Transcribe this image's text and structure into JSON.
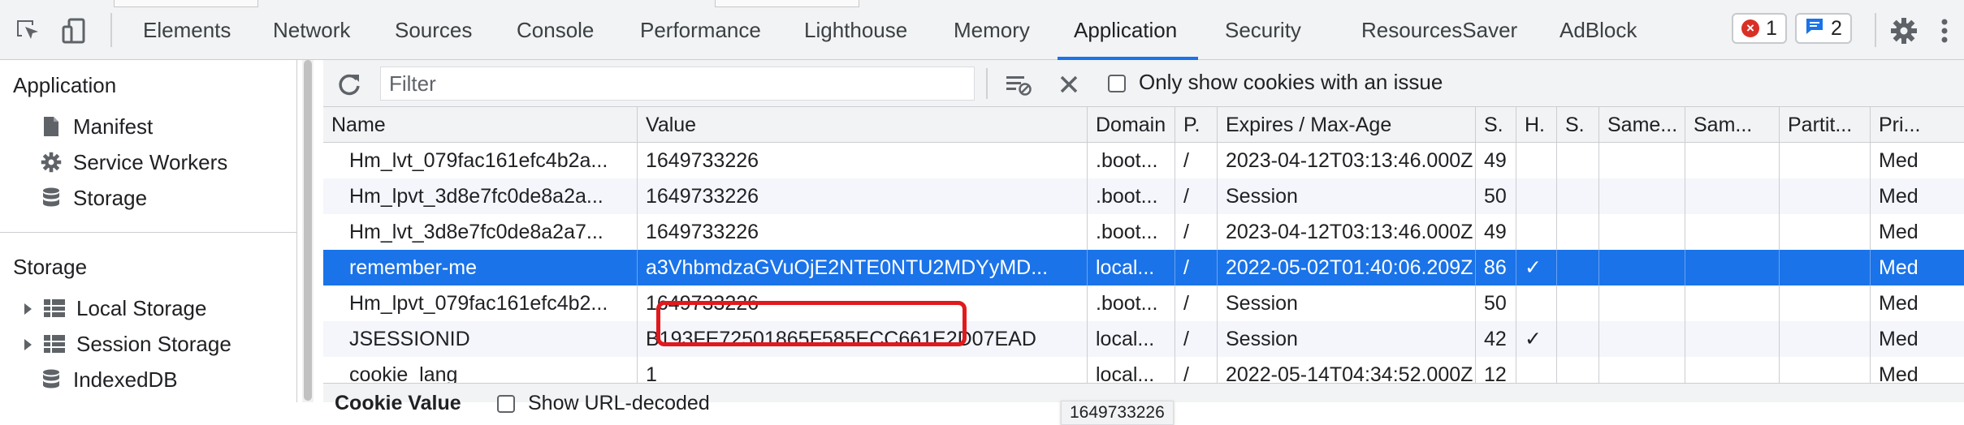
{
  "topbar": {
    "tabs": [
      "Elements",
      "Network",
      "Sources",
      "Console",
      "Performance",
      "Lighthouse",
      "Memory",
      "Application",
      "Security",
      "ResourcesSaver",
      "AdBlock"
    ],
    "active_tab": "Application",
    "error_count": "1",
    "message_count": "2"
  },
  "sidebar": {
    "application_heading": "Application",
    "application_items": [
      {
        "label": "Manifest",
        "icon": "document-icon"
      },
      {
        "label": "Service Workers",
        "icon": "gear-icon"
      },
      {
        "label": "Storage",
        "icon": "database-icon"
      }
    ],
    "storage_heading": "Storage",
    "storage_items": [
      {
        "label": "Local Storage",
        "icon": "grid-icon"
      },
      {
        "label": "Session Storage",
        "icon": "grid-icon"
      },
      {
        "label": "IndexedDB",
        "icon": "database-icon"
      }
    ]
  },
  "toolbar": {
    "filter_placeholder": "Filter",
    "only_issue_label": "Only show cookies with an issue"
  },
  "table": {
    "columns": [
      "Name",
      "Value",
      "Domain",
      "P.",
      "Expires / Max-Age",
      "S.",
      "H.",
      "S.",
      "Same...",
      "Sam...",
      "Partit...",
      "Pri..."
    ],
    "rows": [
      {
        "name": "Hm_lvt_079fac161efc4b2a...",
        "value": "1649733226",
        "domain": ".boot...",
        "path": "/",
        "expires": "2023-04-12T03:13:46.000Z",
        "size": "49",
        "http": "",
        "priority": "Med"
      },
      {
        "name": "Hm_lpvt_3d8e7fc0de8a2a...",
        "value": "1649733226",
        "domain": ".boot...",
        "path": "/",
        "expires": "Session",
        "size": "50",
        "http": "",
        "priority": "Med"
      },
      {
        "name": "Hm_lvt_3d8e7fc0de8a2a7...",
        "value": "1649733226",
        "domain": ".boot...",
        "path": "/",
        "expires": "2023-04-12T03:13:46.000Z",
        "size": "49",
        "http": "",
        "priority": "Med"
      },
      {
        "name": "remember-me",
        "value": "a3VhbmdzaGVuOjE2NTE0NTU2MDYyMD...",
        "domain": "local...",
        "path": "/",
        "expires": "2022-05-02T01:40:06.209Z",
        "size": "86",
        "http": "✓",
        "priority": "Med"
      },
      {
        "name": "Hm_lpvt_079fac161efc4b2...",
        "value": "1649733226",
        "domain": ".boot...",
        "path": "/",
        "expires": "Session",
        "size": "50",
        "http": "",
        "priority": "Med"
      },
      {
        "name": "JSESSIONID",
        "value": "B193FE72501865F585ECC661E2D07EAD",
        "domain": "local...",
        "path": "/",
        "expires": "Session",
        "size": "42",
        "http": "✓",
        "priority": "Med"
      },
      {
        "name": "cookie_lang",
        "value": "1",
        "domain": "local...",
        "path": "/",
        "expires": "2022-05-14T04:34:52.000Z",
        "size": "12",
        "http": "",
        "priority": "Med"
      }
    ],
    "selected_index": 3,
    "tooltip": "1649733226"
  },
  "bottom": {
    "cookie_value_label": "Cookie Value",
    "show_url_decoded_label": "Show URL-decoded"
  },
  "colors": {
    "accent": "#1a73e8",
    "highlight_box": "#e1191d",
    "error": "#d93025"
  }
}
